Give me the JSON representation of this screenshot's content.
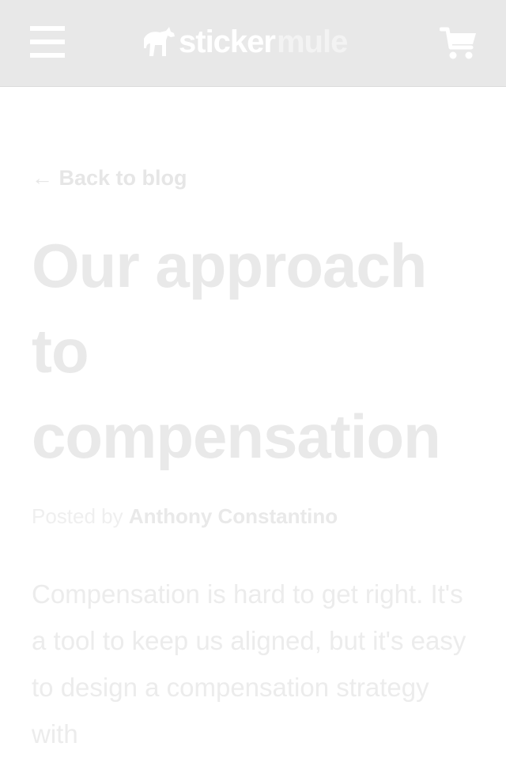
{
  "header": {
    "menu_icon": "hamburger-menu-icon",
    "logo_part1": "sticker",
    "logo_part2": "mule",
    "logo_icon": "mule-logo-icon",
    "cart_icon": "shopping-cart-icon",
    "background": "#e8e8e8"
  },
  "article": {
    "back_link": "← Back to blog",
    "title": "Our approach to compensation",
    "byline_prefix": "Posted by ",
    "author": "Anthony Constantino",
    "body": "Compensation is hard to get right. It's a tool to keep us aligned, but it's easy to design a compensation strategy with"
  }
}
